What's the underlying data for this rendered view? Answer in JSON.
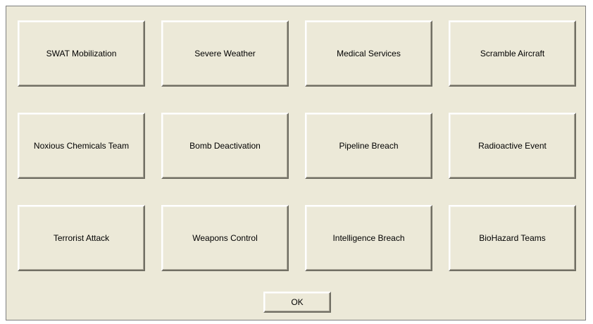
{
  "buttons": [
    {
      "label": "SWAT Mobilization",
      "name": "swat-mobilization-button"
    },
    {
      "label": "Severe Weather",
      "name": "severe-weather-button"
    },
    {
      "label": "Medical Services",
      "name": "medical-services-button"
    },
    {
      "label": "Scramble Aircraft",
      "name": "scramble-aircraft-button"
    },
    {
      "label": "Noxious Chemicals Team",
      "name": "noxious-chemicals-team-button"
    },
    {
      "label": "Bomb Deactivation",
      "name": "bomb-deactivation-button"
    },
    {
      "label": "Pipeline Breach",
      "name": "pipeline-breach-button"
    },
    {
      "label": "Radioactive Event",
      "name": "radioactive-event-button"
    },
    {
      "label": "Terrorist Attack",
      "name": "terrorist-attack-button"
    },
    {
      "label": "Weapons Control",
      "name": "weapons-control-button"
    },
    {
      "label": "Intelligence Breach",
      "name": "intelligence-breach-button"
    },
    {
      "label": "BioHazard Teams",
      "name": "biohazard-teams-button"
    }
  ],
  "ok_label": "OK",
  "colors": {
    "dialog_background": "#ece9d8",
    "button_highlight": "#ffffff",
    "button_shadow": "#716f64"
  }
}
